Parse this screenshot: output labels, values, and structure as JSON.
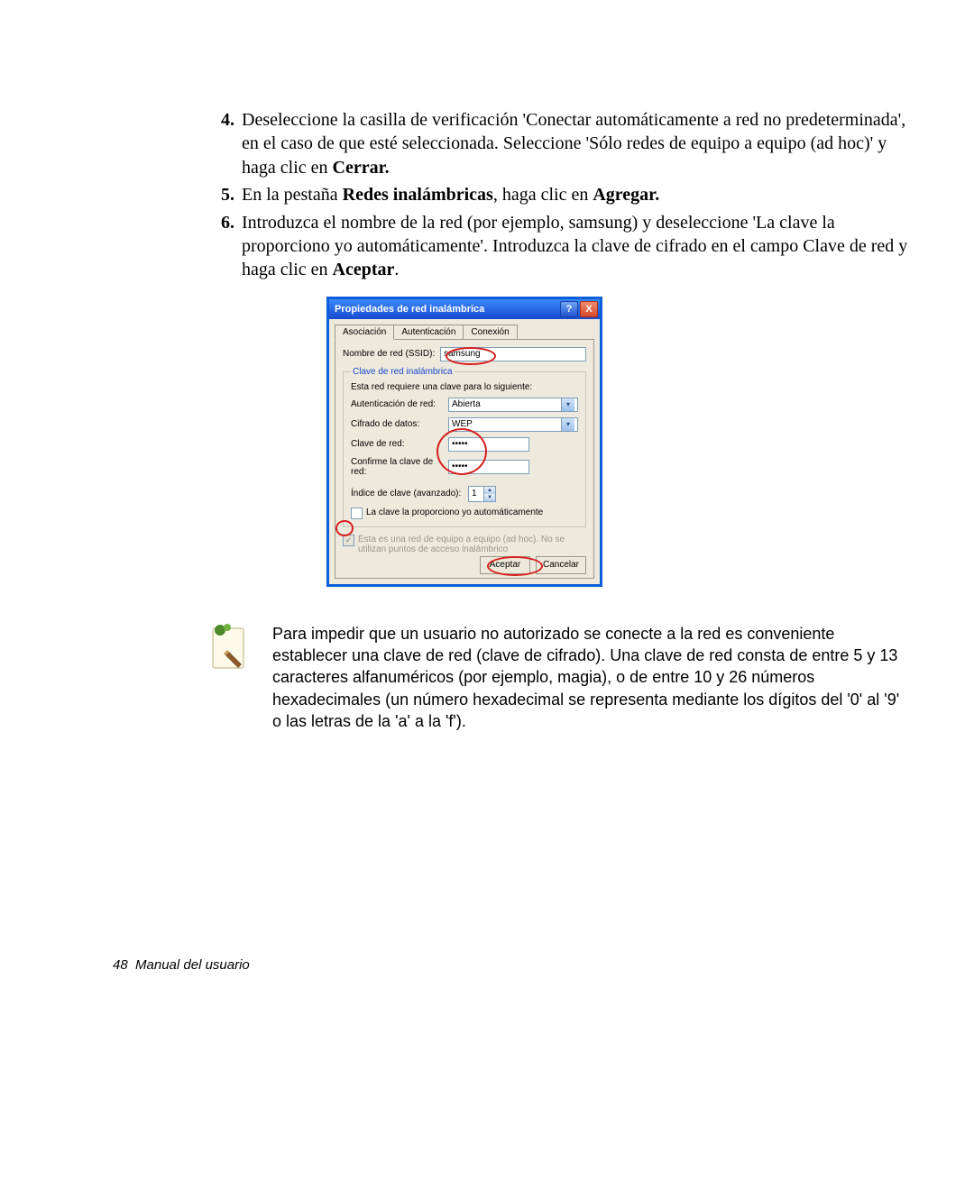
{
  "steps": [
    {
      "num": "4.",
      "pre": "Deseleccione la casilla de verificación 'Conectar automáticamente a red no predeterminada', en el caso de que esté seleccionada. Seleccione 'Sólo redes de equipo a equipo (ad hoc)' y haga clic en ",
      "bold": "Cerrar.",
      "post": ""
    },
    {
      "num": "5.",
      "pre": "En la pestaña ",
      "bold": "Redes inalámbricas",
      "post": ", haga clic en ",
      "bold2": "Agregar.",
      "post2": ""
    },
    {
      "num": "6.",
      "pre": "Introduzca el nombre de la red (por ejemplo, samsung) y deseleccione 'La clave la proporciono yo automáticamente'. Introduzca la clave de cifrado en el campo Clave de red y haga clic en ",
      "bold": "Aceptar",
      "post": "."
    }
  ],
  "dialog": {
    "title": "Propiedades de red inalámbrica",
    "help": "?",
    "close": "X",
    "tabs": {
      "asoc": "Asociación",
      "auth": "Autenticación",
      "conn": "Conexión"
    },
    "labels": {
      "ssid": "Nombre de red (SSID):",
      "group": "Clave de red inalámbrica",
      "need": "Esta red requiere una clave para lo siguiente:",
      "auth": "Autenticación de red:",
      "enc": "Cifrado de datos:",
      "key": "Clave de red:",
      "confirm": "Confirme la clave de red:",
      "index": "Índice de clave (avanzado):",
      "auto": "La clave la proporciono yo automáticamente",
      "adhoc": "Ésta es una red de equipo a equipo (ad hoc). No se utilizan puntos de acceso inalámbrico"
    },
    "values": {
      "ssid": "samsung",
      "auth": "Abierta",
      "enc": "WEP",
      "key": "•••••",
      "confirm": "•••••",
      "index": "1"
    },
    "buttons": {
      "ok": "Aceptar",
      "cancel": "Cancelar"
    }
  },
  "note": "Para impedir que un usuario no autorizado se conecte a la red es conveniente establecer una clave de red (clave de cifrado). Una clave de red consta de entre 5 y 13 caracteres alfanuméricos (por ejemplo, magia), o de entre 10 y 26 números hexadecimales (un número hexadecimal se representa mediante los dígitos del '0' al '9' o las letras de la 'a' a la 'f').",
  "footer": {
    "page": "48",
    "title": "Manual del usuario"
  }
}
